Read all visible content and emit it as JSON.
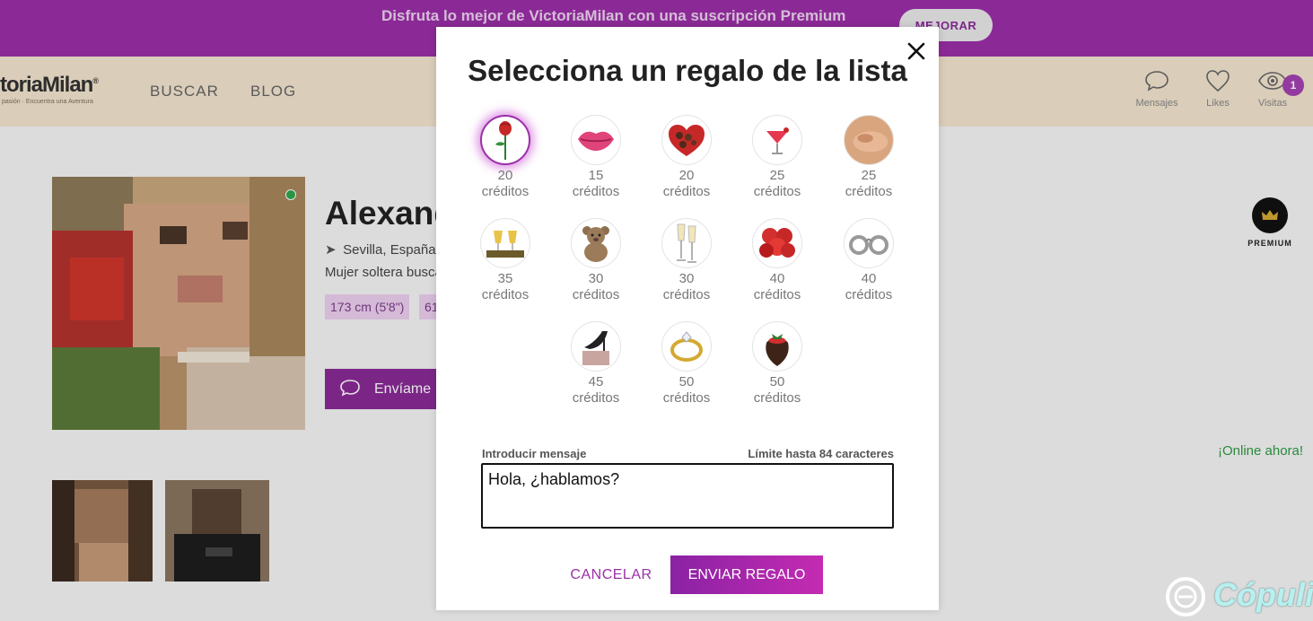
{
  "promo": {
    "text": "Disfruta lo mejor de VictoriaMilan con una suscripción Premium",
    "button": "MEJORAR"
  },
  "nav": {
    "logo": "toriaMilan",
    "logo_mark": "®",
    "tagline": "pasión · Encuentra una Aventura",
    "links": [
      "BUSCAR",
      "BLOG"
    ],
    "icons": [
      {
        "label": "Mensajes",
        "icon": "chat-icon"
      },
      {
        "label": "Likes",
        "icon": "heart-icon"
      },
      {
        "label": "Visitas",
        "icon": "eye-icon"
      }
    ],
    "visits_badge": "1"
  },
  "profile": {
    "name": "Alexand",
    "location": "Sevilla, España",
    "description": "Mujer soltera busca",
    "tags": [
      "173 cm (5'8\")",
      "61"
    ],
    "message_button": "Envíame",
    "premium_label": "PREMIUM",
    "online_text": "¡Online ahora!"
  },
  "modal": {
    "title": "Selecciona un regalo de la lista",
    "gifts": [
      {
        "name": "rose",
        "price": "20",
        "unit": "créditos",
        "selected": true
      },
      {
        "name": "kiss",
        "price": "15",
        "unit": "créditos"
      },
      {
        "name": "chocolates",
        "price": "20",
        "unit": "créditos"
      },
      {
        "name": "cocktail",
        "price": "25",
        "unit": "créditos"
      },
      {
        "name": "massage",
        "price": "25",
        "unit": "créditos"
      },
      {
        "name": "champagne-glasses",
        "price": "35",
        "unit": "créditos"
      },
      {
        "name": "teddy-bear",
        "price": "30",
        "unit": "créditos"
      },
      {
        "name": "toast",
        "price": "30",
        "unit": "créditos"
      },
      {
        "name": "roses-bouquet",
        "price": "40",
        "unit": "créditos"
      },
      {
        "name": "handcuffs",
        "price": "40",
        "unit": "créditos"
      },
      {
        "name": "high-heel",
        "price": "45",
        "unit": "créditos"
      },
      {
        "name": "ring",
        "price": "50",
        "unit": "créditos"
      },
      {
        "name": "chocolate-strawberry",
        "price": "50",
        "unit": "créditos"
      }
    ],
    "message_label": "Introducir mensaje",
    "message_limit": "Límite hasta 84 caracteres",
    "message_value": "Hola, ¿hablamos?",
    "cancel": "CANCELAR",
    "send": "ENVIAR REGALO"
  },
  "watermark": "Cópuli",
  "colors": {
    "brand": "#9b2fa8",
    "accent_gradient_end": "#c42bb2",
    "nav_bg": "#f3e5cf",
    "online": "#2e9a45"
  }
}
